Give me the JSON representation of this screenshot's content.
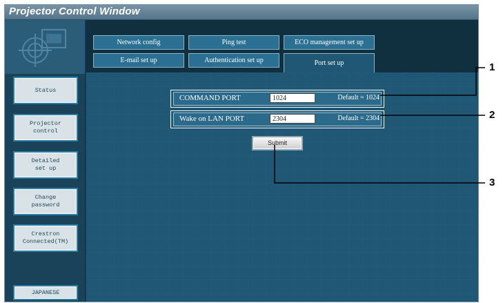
{
  "window": {
    "title": "Projector Control Window"
  },
  "sidebar": {
    "buttons": [
      {
        "id": "status",
        "label": "Status"
      },
      {
        "id": "projector-control",
        "label": "Projector\ncontrol"
      },
      {
        "id": "detailed-setup",
        "label": "Detailed\nset up"
      },
      {
        "id": "change-password",
        "label": "Change\npassword"
      },
      {
        "id": "crestron",
        "label": "Crestron\nConnected(TM)"
      }
    ],
    "language_button": "JAPANESE"
  },
  "tabs": {
    "row1": [
      "Network config",
      "Ping test",
      "ECO management set up"
    ],
    "row2": [
      "E-mail set up",
      "Authentication set up",
      "Port set up"
    ],
    "active": "Port set up"
  },
  "form": {
    "command_port": {
      "label": "COMMAND PORT",
      "value": "1024",
      "default": "Default = 1024"
    },
    "wol_port": {
      "label": "Wake on LAN PORT",
      "value": "2304",
      "default": "Default = 2304"
    },
    "submit_label": "Submit"
  },
  "callouts": [
    "1",
    "2",
    "3"
  ],
  "colors": {
    "frame": "#11384f",
    "main": "#1f5775",
    "tab": "#2b6f93",
    "title_bar": "#5f7f93"
  }
}
